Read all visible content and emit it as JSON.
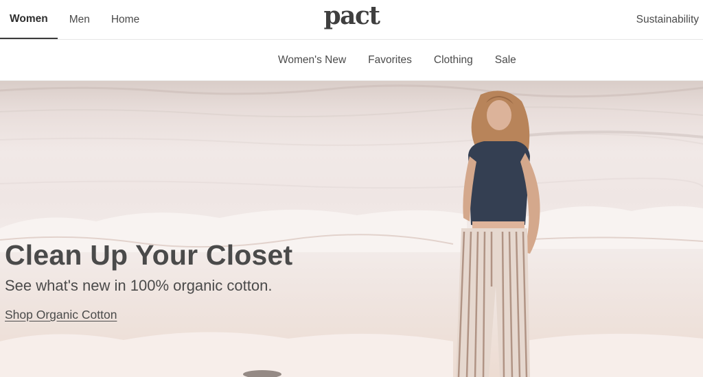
{
  "header": {
    "gender_tabs": [
      {
        "label": "Women",
        "active": true
      },
      {
        "label": "Men",
        "active": false
      },
      {
        "label": "Home",
        "active": false
      }
    ],
    "logo_text": "pact",
    "utility_link": "Sustainability"
  },
  "category_nav": {
    "items": [
      "Women's New",
      "Favorites",
      "Clothing",
      "Sale"
    ]
  },
  "hero": {
    "title": "Clean Up Your Closet",
    "subtitle": "See what's new in 100% organic cotton.",
    "cta_label": "Shop Organic Cotton",
    "image_subject": "woman-walking-on-beach"
  },
  "colors": {
    "text": "#4a4a4a",
    "logo": "#3f3f3f",
    "divider": "#e6e6e6",
    "hero_sand": "#eddcd2",
    "top_navy": "#343f52"
  }
}
